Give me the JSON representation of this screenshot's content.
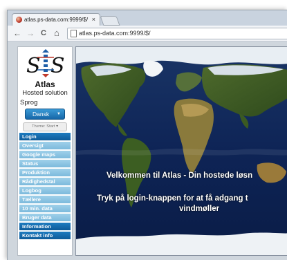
{
  "browser": {
    "tab_title": "atlas.ps-data.com:9999/$/",
    "tab_close": "×",
    "back": "←",
    "forward": "→",
    "reload": "C",
    "home": "⌂",
    "url": "atlas.ps-data.com:9999/$/"
  },
  "sidebar": {
    "brand": "Atlas",
    "hosted": "Hosted solution",
    "sprog_label": "Sprog",
    "language": "Dansk",
    "theme": "Theme: Start",
    "nav": [
      {
        "label": "Login",
        "active": true
      },
      {
        "label": "Oversigt",
        "active": false
      },
      {
        "label": "Google maps",
        "active": false
      },
      {
        "label": "Status",
        "active": false
      },
      {
        "label": "Produktion",
        "active": false
      },
      {
        "label": "Rådighedstal",
        "active": false
      },
      {
        "label": "Logbog",
        "active": false
      },
      {
        "label": "Tællere",
        "active": false
      },
      {
        "label": "10 min. data",
        "active": false
      },
      {
        "label": "Bruger data",
        "active": false
      },
      {
        "label": "Information",
        "active": true
      },
      {
        "label": "Kontakt info",
        "active": true
      }
    ]
  },
  "main": {
    "welcome": "Velkommen til Atlas - Din hostede løsn",
    "instruction_line1": "Tryk på login-knappen for at få adgang t",
    "instruction_line2": "vindmøller"
  }
}
